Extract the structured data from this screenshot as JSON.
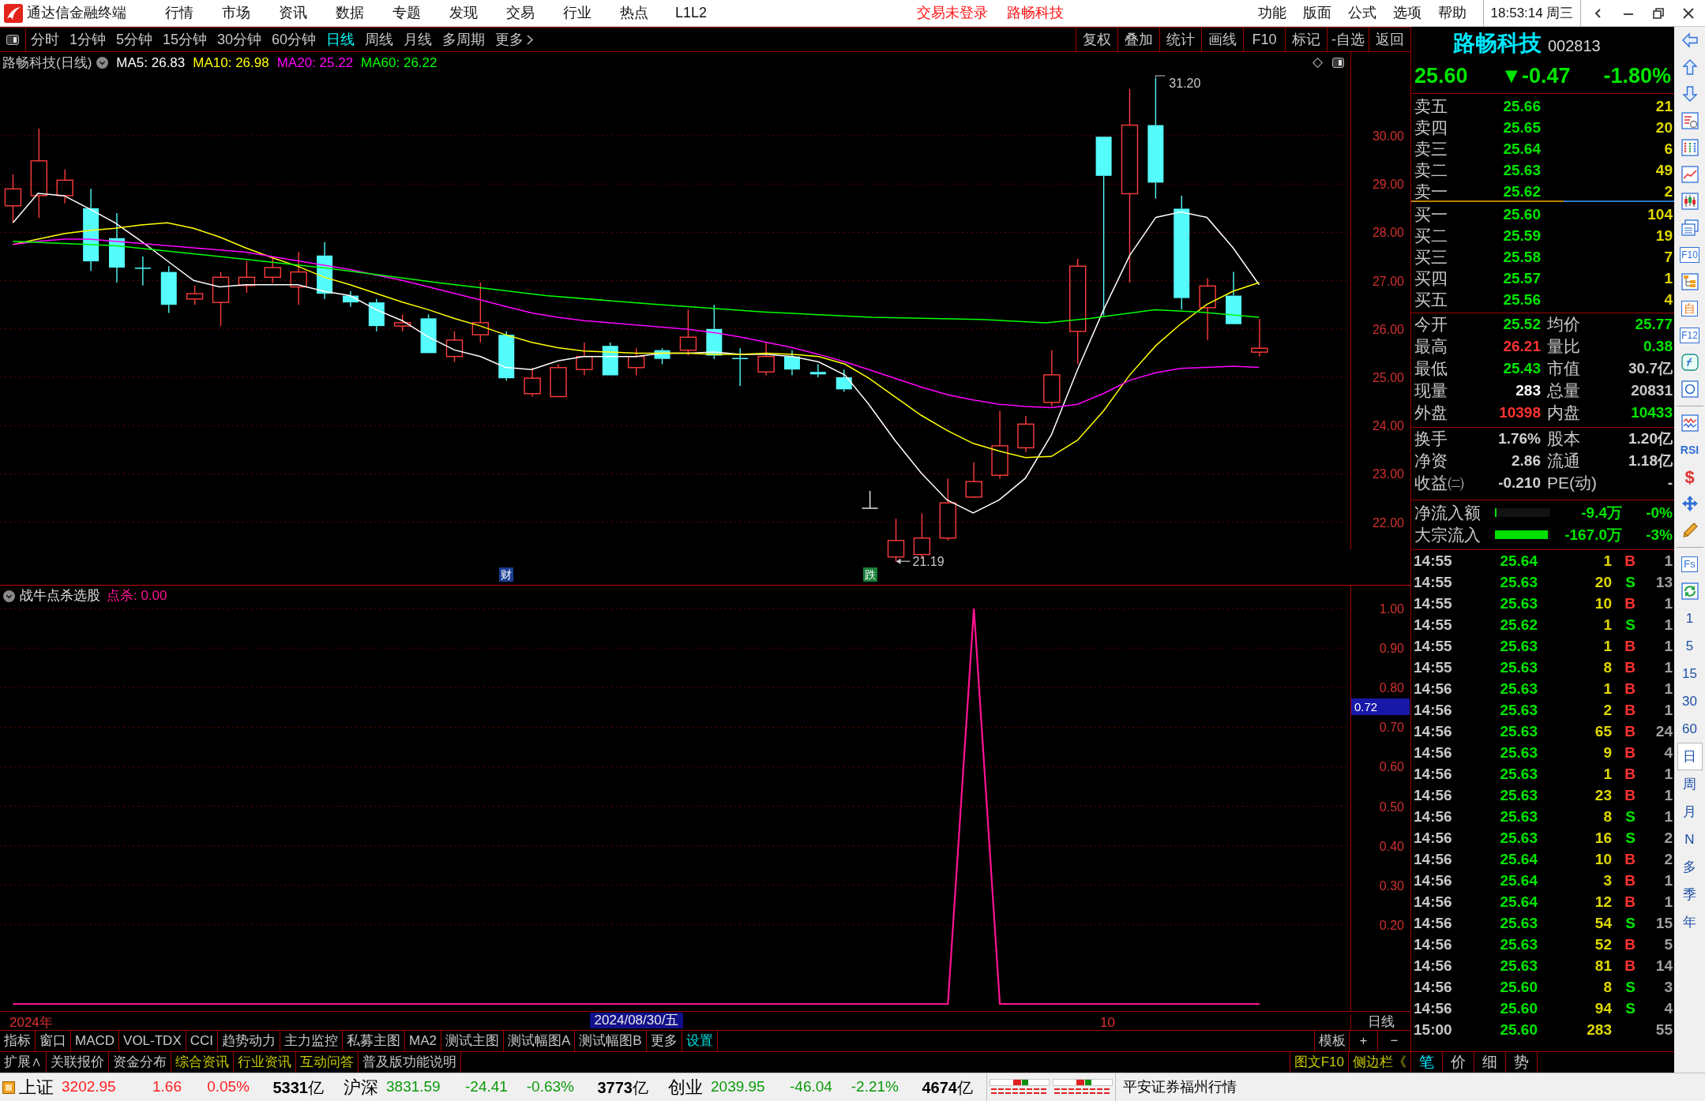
{
  "menu_bar": {
    "app_title": "通达信金融终端",
    "menus": [
      "行情",
      "市场",
      "资讯",
      "数据",
      "专题",
      "发现",
      "交易",
      "行业",
      "热点",
      "L1L2"
    ],
    "notices": [
      "交易未登录",
      "路畅科技"
    ],
    "functions": [
      "功能",
      "版面",
      "公式",
      "选项",
      "帮助"
    ],
    "clock": "18:53:14 周三"
  },
  "period_toolbar": {
    "periods": [
      {
        "label": "分时",
        "selected": false
      },
      {
        "label": "1分钟",
        "selected": false
      },
      {
        "label": "5分钟",
        "selected": false
      },
      {
        "label": "15分钟",
        "selected": false
      },
      {
        "label": "30分钟",
        "selected": false
      },
      {
        "label": "60分钟",
        "selected": false
      },
      {
        "label": "日线",
        "selected": true
      },
      {
        "label": "周线",
        "selected": false
      },
      {
        "label": "月线",
        "selected": false
      },
      {
        "label": "多周期",
        "selected": false
      }
    ],
    "more": "更多",
    "actions": [
      "复权",
      "叠加",
      "统计",
      "画线",
      "F10",
      "标记",
      "-自选",
      "返回"
    ]
  },
  "main_chart": {
    "title": "路畅科技(日线)",
    "moving_averages": [
      {
        "label": "MA5: 26.83",
        "color": "#ffffff"
      },
      {
        "label": "MA10: 26.98",
        "color": "#ffff00"
      },
      {
        "label": "MA20: 25.22",
        "color": "#ff00ff"
      },
      {
        "label": "MA60: 26.22",
        "color": "#00ff00"
      }
    ],
    "price_axis": [
      "30.00",
      "29.00",
      "28.00",
      "27.00",
      "26.00",
      "25.00",
      "24.00",
      "23.00",
      "22.00"
    ],
    "high_label": "31.20",
    "low_label": "21.19",
    "event_tags": [
      {
        "text": "财",
        "color": "#1c3f94"
      },
      {
        "text": "跌",
        "color": "#17803a"
      }
    ]
  },
  "indicator": {
    "name": "战牛点杀选股",
    "reading": "点杀: 0.00",
    "cursor_value": "0.72",
    "chart_data": {
      "type": "line",
      "grid": true,
      "categories": [
        null,
        null,
        null,
        null,
        null,
        null,
        null,
        null,
        null,
        null,
        null,
        null,
        null,
        null,
        null,
        null,
        null,
        null,
        null,
        null,
        null,
        null,
        null,
        null,
        null,
        null,
        null,
        null,
        null,
        null,
        null,
        null,
        null,
        null,
        null,
        null,
        null,
        null,
        null,
        null,
        null,
        null,
        null,
        null,
        null,
        null,
        null,
        null,
        null,
        null,
        null,
        null
      ],
      "ylim": [
        -0.018,
        1.06
      ],
      "yticks": [
        {
          "value": 1,
          "label": "1.00"
        },
        {
          "value": 0.9,
          "label": "0.90"
        },
        {
          "value": 0.8,
          "label": "0.80"
        },
        {
          "value": 0.7,
          "label": "0.70"
        },
        {
          "value": 0.6,
          "label": "0.60"
        },
        {
          "value": 0.5,
          "label": "0.50"
        },
        {
          "value": 0.4,
          "label": "0.40"
        },
        {
          "value": 0.3,
          "label": "0.30"
        },
        {
          "value": 0.2,
          "label": "0.20"
        }
      ],
      "series": [
        {
          "color": "#ff1493",
          "values": [
            0,
            0,
            0,
            0,
            0,
            0,
            0,
            0,
            0,
            0,
            0,
            0,
            0,
            0,
            0,
            0,
            0,
            0,
            0,
            0,
            0,
            0,
            0,
            0,
            0,
            0,
            0,
            0,
            0,
            0,
            0,
            0,
            0,
            0,
            0,
            0,
            0,
            1,
            0,
            0,
            0,
            0,
            0,
            0,
            0,
            0,
            0,
            0,
            0,
            null,
            null,
            null
          ]
        }
      ]
    }
  },
  "date_axis": {
    "year": "2024年",
    "cursor_date": "2024/08/30/五",
    "month": "10",
    "period": "日线"
  },
  "indicator_tabs": [
    {
      "label": "指标",
      "color": "#c8c8c8"
    },
    {
      "label": "窗口",
      "color": "#c8c8c8"
    },
    {
      "label": "MACD",
      "color": "#c8c8c8"
    },
    {
      "label": "VOL-TDX",
      "color": "#c8c8c8"
    },
    {
      "label": "CCI",
      "color": "#c8c8c8"
    },
    {
      "label": "趋势动力",
      "color": "#c8c8c8"
    },
    {
      "label": "主力监控",
      "color": "#c8c8c8"
    },
    {
      "label": "私募主图",
      "color": "#c8c8c8"
    },
    {
      "label": "MA2",
      "color": "#c8c8c8"
    },
    {
      "label": "测试主图",
      "color": "#c8c8c8"
    },
    {
      "label": "测试幅图A",
      "color": "#c8c8c8"
    },
    {
      "label": "测试幅图B",
      "color": "#c8c8c8"
    },
    {
      "label": "更多",
      "color": "#c8c8c8"
    },
    {
      "label": "设置",
      "color": "#00e0e0"
    }
  ],
  "template_controls": [
    "模板",
    "+",
    "−"
  ],
  "info_tabs": [
    {
      "label": "扩展∧",
      "color": "#c8c8c8"
    },
    {
      "label": "关联报价",
      "color": "#c8c8c8"
    },
    {
      "label": "资金分布",
      "color": "#c8c8c8"
    },
    {
      "label": "综合资讯",
      "color": "#c8c800"
    },
    {
      "label": "行业资讯",
      "color": "#c8c800"
    },
    {
      "label": "互动问答",
      "color": "#c8c800"
    },
    {
      "label": "普及版功能说明",
      "color": "#c8c8c8"
    }
  ],
  "side_links": [
    {
      "label": "图文F10",
      "color": "#c8c800"
    },
    {
      "label": "侧边栏《",
      "color": "#c8c800"
    }
  ],
  "quote_panel": {
    "name": "路畅科技",
    "code": "002813",
    "price": "25.60",
    "change": "▼-0.47",
    "change_pct": "-1.80%",
    "asks": [
      {
        "label": "卖五",
        "price": "25.66",
        "volume": "21"
      },
      {
        "label": "卖四",
        "price": "25.65",
        "volume": "20"
      },
      {
        "label": "卖三",
        "price": "25.64",
        "volume": "6"
      },
      {
        "label": "卖二",
        "price": "25.63",
        "volume": "49"
      },
      {
        "label": "卖一",
        "price": "25.62",
        "volume": "2"
      }
    ],
    "bids": [
      {
        "label": "买一",
        "price": "25.60",
        "volume": "104"
      },
      {
        "label": "买二",
        "price": "25.59",
        "volume": "19"
      },
      {
        "label": "买三",
        "price": "25.58",
        "volume": "7"
      },
      {
        "label": "买四",
        "price": "25.57",
        "volume": "1"
      },
      {
        "label": "买五",
        "price": "25.56",
        "volume": "4"
      }
    ],
    "stats": [
      {
        "label": "今开",
        "value": "25.52",
        "color": "#00e600"
      },
      {
        "label": "均价",
        "value": "25.77",
        "color": "#00e600"
      },
      {
        "label": "最高",
        "value": "26.21",
        "color": "#ff3232"
      },
      {
        "label": "量比",
        "value": "0.38",
        "color": "#00e600"
      },
      {
        "label": "最低",
        "value": "25.43",
        "color": "#00e600"
      },
      {
        "label": "市值",
        "value": "30.7亿",
        "color": "#c8c8c8"
      },
      {
        "label": "现量",
        "value": "283",
        "color": "#ffffff"
      },
      {
        "label": "总量",
        "value": "20831",
        "color": "#c8c8c8"
      },
      {
        "label": "外盘",
        "value": "10398",
        "color": "#ff3232"
      },
      {
        "label": "内盘",
        "value": "10433",
        "color": "#00e600"
      }
    ],
    "fundamentals": [
      {
        "label": "换手",
        "value": "1.76%"
      },
      {
        "label": "股本",
        "value": "1.20亿"
      },
      {
        "label": "净资",
        "value": "2.86"
      },
      {
        "label": "流通",
        "value": "1.18亿"
      },
      {
        "label": "收益㈡",
        "value": "-0.210"
      },
      {
        "label": "PE(动)",
        "value": "-"
      }
    ],
    "flows": [
      {
        "label": "净流入额",
        "level": 0.03,
        "amount": "-9.4万",
        "pct": "-0%"
      },
      {
        "label": "大宗流入",
        "level": 0.95,
        "amount": "-167.0万",
        "pct": "-3%"
      }
    ],
    "ticks": [
      {
        "time": "14:55",
        "price": "25.64",
        "volume": "1",
        "side": "B",
        "color": "#ff3232",
        "count": "1"
      },
      {
        "time": "14:55",
        "price": "25.63",
        "volume": "20",
        "side": "S",
        "color": "#00e600",
        "count": "13"
      },
      {
        "time": "14:55",
        "price": "25.63",
        "volume": "10",
        "side": "B",
        "color": "#ff3232",
        "count": "1"
      },
      {
        "time": "14:55",
        "price": "25.62",
        "volume": "1",
        "side": "S",
        "color": "#00e600",
        "count": "1"
      },
      {
        "time": "14:55",
        "price": "25.63",
        "volume": "1",
        "side": "B",
        "color": "#ff3232",
        "count": "1"
      },
      {
        "time": "14:55",
        "price": "25.63",
        "volume": "8",
        "side": "B",
        "color": "#ff3232",
        "count": "1"
      },
      {
        "time": "14:56",
        "price": "25.63",
        "volume": "1",
        "side": "B",
        "color": "#ff3232",
        "count": "1"
      },
      {
        "time": "14:56",
        "price": "25.63",
        "volume": "2",
        "side": "B",
        "color": "#ff3232",
        "count": "1"
      },
      {
        "time": "14:56",
        "price": "25.63",
        "volume": "65",
        "side": "B",
        "color": "#ff3232",
        "count": "24"
      },
      {
        "time": "14:56",
        "price": "25.63",
        "volume": "9",
        "side": "B",
        "color": "#ff3232",
        "count": "4"
      },
      {
        "time": "14:56",
        "price": "25.63",
        "volume": "1",
        "side": "B",
        "color": "#ff3232",
        "count": "1"
      },
      {
        "time": "14:56",
        "price": "25.63",
        "volume": "23",
        "side": "B",
        "color": "#ff3232",
        "count": "1"
      },
      {
        "time": "14:56",
        "price": "25.63",
        "volume": "8",
        "side": "S",
        "color": "#00e600",
        "count": "1"
      },
      {
        "time": "14:56",
        "price": "25.63",
        "volume": "16",
        "side": "S",
        "color": "#00e600",
        "count": "2"
      },
      {
        "time": "14:56",
        "price": "25.64",
        "volume": "10",
        "side": "B",
        "color": "#ff3232",
        "count": "2"
      },
      {
        "time": "14:56",
        "price": "25.64",
        "volume": "3",
        "side": "B",
        "color": "#ff3232",
        "count": "1"
      },
      {
        "time": "14:56",
        "price": "25.64",
        "volume": "12",
        "side": "B",
        "color": "#ff3232",
        "count": "1"
      },
      {
        "time": "14:56",
        "price": "25.63",
        "volume": "54",
        "side": "S",
        "color": "#00e600",
        "count": "15"
      },
      {
        "time": "14:56",
        "price": "25.63",
        "volume": "52",
        "side": "B",
        "color": "#ff3232",
        "count": "5"
      },
      {
        "time": "14:56",
        "price": "25.63",
        "volume": "81",
        "side": "B",
        "color": "#ff3232",
        "count": "14"
      },
      {
        "time": "14:56",
        "price": "25.60",
        "volume": "8",
        "side": "S",
        "color": "#00e600",
        "count": "3"
      },
      {
        "time": "14:56",
        "price": "25.60",
        "volume": "94",
        "side": "S",
        "color": "#00e600",
        "count": "4"
      },
      {
        "time": "15:00",
        "price": "25.60",
        "volume": "283",
        "count": "55"
      }
    ],
    "tabs": [
      {
        "label": "笔",
        "selected": true
      },
      {
        "label": "价",
        "selected": false
      },
      {
        "label": "细",
        "selected": false
      },
      {
        "label": "势",
        "selected": false
      }
    ]
  },
  "sidebar": {
    "tool_labels": [
      "F10",
      "自",
      "F12",
      "RSI",
      "$",
      "Fs"
    ],
    "periods": [
      {
        "label": "1",
        "selected": false
      },
      {
        "label": "5",
        "selected": false
      },
      {
        "label": "15",
        "selected": false
      },
      {
        "label": "30",
        "selected": false
      },
      {
        "label": "60",
        "selected": false
      },
      {
        "label": "日",
        "selected": true
      },
      {
        "label": "周",
        "selected": false
      },
      {
        "label": "月",
        "selected": false
      },
      {
        "label": "N",
        "selected": false
      },
      {
        "label": "多",
        "selected": false
      },
      {
        "label": "季",
        "selected": false
      },
      {
        "label": "年",
        "selected": false
      }
    ]
  },
  "status_bar": {
    "indices": [
      {
        "name": "上证",
        "value": "3202.95",
        "change": "1.66",
        "pct": "0.05%",
        "amount": "**5331**亿",
        "color": "#ff2020"
      },
      {
        "name": "沪深",
        "value": "3831.59",
        "change": "-24.41",
        "pct": "-0.63%",
        "amount": "**3773**亿",
        "color": "#0a9a0a"
      },
      {
        "name": "创业",
        "value": "2039.95",
        "change": "-46.04",
        "pct": "-2.21%",
        "amount": "**4674**亿",
        "color": "#0a9a0a"
      }
    ],
    "broker": "平安证券福州行情"
  }
}
